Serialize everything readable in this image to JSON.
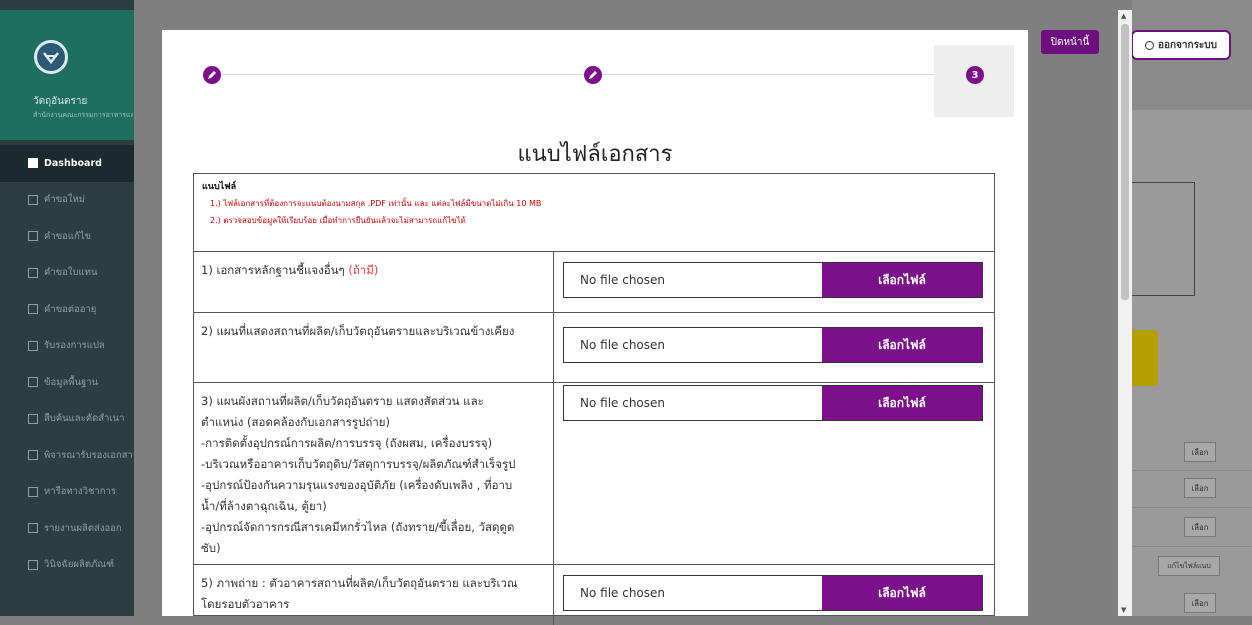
{
  "sidebar": {
    "brand_name": "วัตถุอันตราย",
    "brand_sub": "สำนักงานคณะกรรมการอาหารและยา",
    "items": [
      {
        "label": "Dashboard",
        "icon": "grid-icon",
        "active": true
      },
      {
        "label": "คำขอใหม่",
        "icon": "document-icon"
      },
      {
        "label": "คำขอแก้ไข",
        "icon": "edit-icon"
      },
      {
        "label": "คำขอใบแทน",
        "icon": "copy-icon"
      },
      {
        "label": "คำขอต่ออายุ",
        "icon": "renew-icon"
      },
      {
        "label": "รับรองการแปล",
        "icon": "translate-icon"
      },
      {
        "label": "ข้อมูลพื้นฐาน",
        "icon": "list-icon"
      },
      {
        "label": "สืบค้นและคัดสำเนา",
        "icon": "search-copy-icon"
      },
      {
        "label": "พิจารณารับรองเอกสาร",
        "icon": "book-icon"
      },
      {
        "label": "หารือทางวิชาการ",
        "icon": "chat-icon"
      },
      {
        "label": "รายงานผลิตส่งออก",
        "icon": "report-icon"
      },
      {
        "label": "วินิจฉัยผลิตภัณฑ์",
        "icon": "flask-icon"
      }
    ]
  },
  "stepper": {
    "step3_label": "3"
  },
  "form": {
    "title": "แนบไฟล์เอกสาร",
    "notes_title": "แนบไฟล์",
    "notes": [
      "1.) ไฟล์เอกสารที่ต้องการจะแนบต้องนามสกุล .PDF เท่านั้น และ แต่ละไฟล์มีขนาดไม่เกิน 10 MB",
      "2.) ตรวจสอบข้อมูลให้เรียบร้อย เมื่อทำการยืนยันแล้วจะไม่สามารถแก้ไขได้"
    ],
    "rows": [
      {
        "desc": "1) เอกสารหลักฐานชี้แจงอื่นๆ",
        "optional": "(ถ้ามี)",
        "file_text": "No file chosen",
        "button": "เลือกไฟล์"
      },
      {
        "desc": "2) แผนที่แสดงสถานที่ผลิต/เก็บวัตถุอันตรายและบริเวณข้างเคียง",
        "file_text": "No file chosen",
        "button": "เลือกไฟล์"
      },
      {
        "desc_lines": [
          "3) แผนผังสถานที่ผลิต/เก็บวัตถุอันตราย แสดงสัดส่วน และ",
          "ตำแหน่ง (สอดคล้องกับเอกสารรูปถ่าย)",
          "-การติดตั้งอุปกรณ์การผลิต/การบรรจุ (ถังผสม, เครื่องบรรจุ)",
          "-บริเวณหรืออาคารเก็บวัตถุดิบ/วัสดุการบรรจุ/ผลิตภัณฑ์สำเร็จรูป",
          "-อุปกรณ์ป้องกันความรุนแรงของอุบัติภัย (เครื่องดับเพลิง , ที่อาบ",
          "น้ำ/ที่ล้างตาฉุกเฉิน, ตู้ยา)",
          "-อุปกรณ์จัดการกรณีสารเคมีหกรั่วไหล (ถังทราย/ขี้เลื่อย, วัสดุดูด",
          "ซับ)"
        ],
        "file_text": "No file chosen",
        "button": "เลือกไฟล์"
      },
      {
        "desc_lines": [
          "5) ภาพถ่าย : ตัวอาคารสถานที่ผลิต/เก็บวัตถุอันตราย และบริเวณ",
          "โดยรอบตัวอาคาร"
        ],
        "file_text": "No file chosen",
        "button": "เลือกไฟล์"
      }
    ]
  },
  "close_button": "ปิดหน้านี้",
  "logout_button": "ออกจากระบบ",
  "background": {
    "select_labels": [
      "เลือก",
      "เลือก",
      "เลือก",
      "แก้ไขไฟล์แนบ",
      "เลือก"
    ]
  },
  "colors": {
    "accent": "#7c0f8a",
    "sidebar": "#2d3e40",
    "brand": "#1f6f60",
    "warning": "#d40000"
  }
}
